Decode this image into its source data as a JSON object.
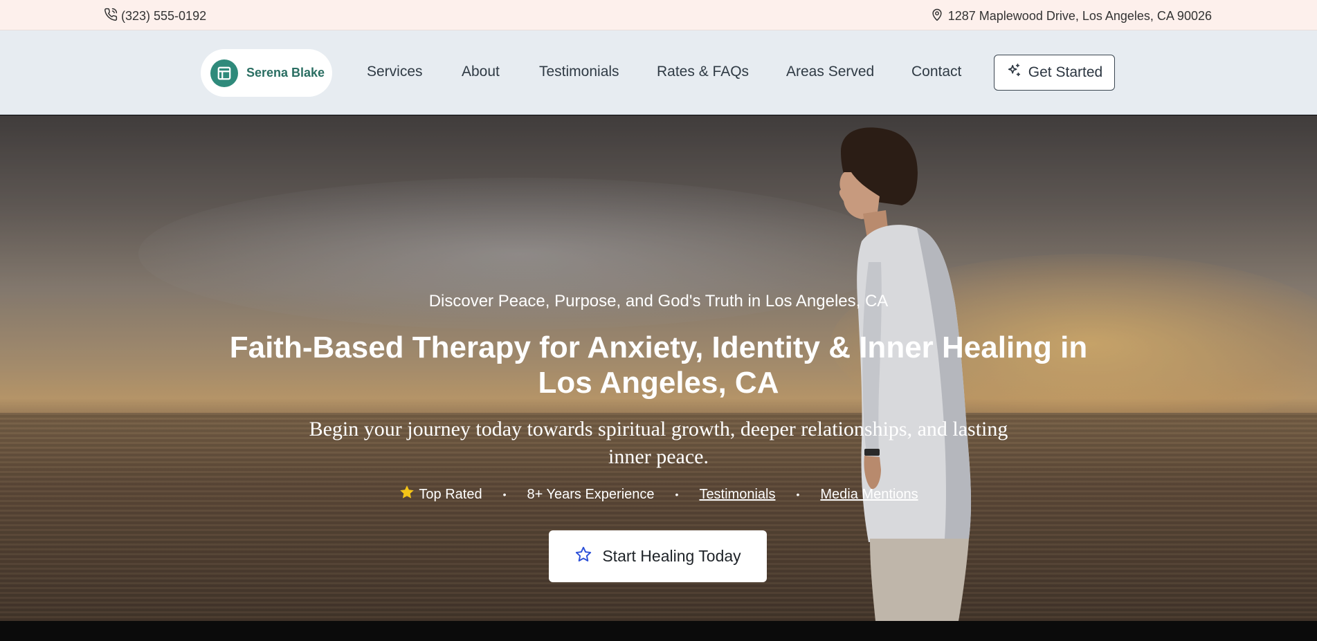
{
  "topbar": {
    "phone": "(323) 555-0192",
    "address": "1287 Maplewood Drive, Los Angeles, CA 90026",
    "phone_icon": "phone-icon",
    "address_icon": "map-pin-icon"
  },
  "nav": {
    "brand_name": "Serena Blake",
    "brand_icon": "layout-icon",
    "links": [
      "Services",
      "About",
      "Testimonials",
      "Rates & FAQs",
      "Areas Served",
      "Contact"
    ],
    "cta_label": "Get Started",
    "cta_icon": "sparkles-icon"
  },
  "hero": {
    "tagline": "Discover Peace, Purpose, and God's Truth in Los Angeles, CA",
    "headline": "Faith-Based Therapy for Anxiety, Identity & Inner Healing in Los Angeles, CA",
    "subheadline": "Begin your journey today towards spiritual growth, deeper relationships, and lasting inner peace.",
    "badges": {
      "top_rated": "Top Rated",
      "experience": "8+ Years Experience",
      "testimonials_link": "Testimonials",
      "media_link": "Media Mentions",
      "separator": "•"
    },
    "button_label": "Start Healing Today",
    "button_icon": "star-outline-icon"
  },
  "colors": {
    "topbar_bg": "#fdf0ec",
    "nav_bg": "#e7ecf1",
    "brand_accent": "#2f8a7b",
    "star_gold": "#f5c518",
    "button_icon_blue": "#2b4fd8"
  }
}
